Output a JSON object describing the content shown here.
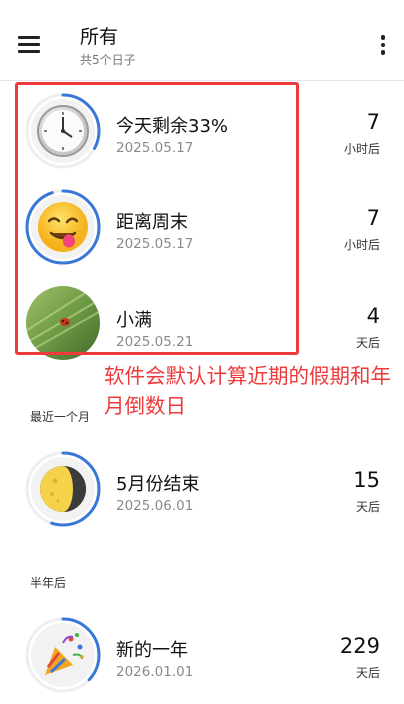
{
  "header": {
    "title": "所有",
    "subtitle": "共5个日子"
  },
  "annotation": "软件会默认计算近期的假期和年月倒数日",
  "sections": {
    "recent_month": "最近一个月",
    "half_year": "半年后"
  },
  "items": [
    {
      "name": "今天剩余33%",
      "date": "2025.05.17",
      "count": "7",
      "unit": "小时后",
      "icon": "clock-icon",
      "progress": 0.33
    },
    {
      "name": "距离周末",
      "date": "2025.05.17",
      "count": "7",
      "unit": "小时后",
      "icon": "smiling-face-icon",
      "progress": 0.95
    },
    {
      "name": "小满",
      "date": "2025.05.21",
      "count": "4",
      "unit": "天后",
      "icon": "ladybug-photo",
      "progress": 0.5
    },
    {
      "name": "5月份结束",
      "date": "2025.06.01",
      "count": "15",
      "unit": "天后",
      "icon": "moon-icon",
      "progress": 0.55
    },
    {
      "name": "新的一年",
      "date": "2026.01.01",
      "count": "229",
      "unit": "天后",
      "icon": "party-popper-icon",
      "progress": 0.37
    }
  ],
  "colors": {
    "ring": "#3a78d8",
    "track": "#eeeeee",
    "annotation": "#ee3a3a"
  }
}
